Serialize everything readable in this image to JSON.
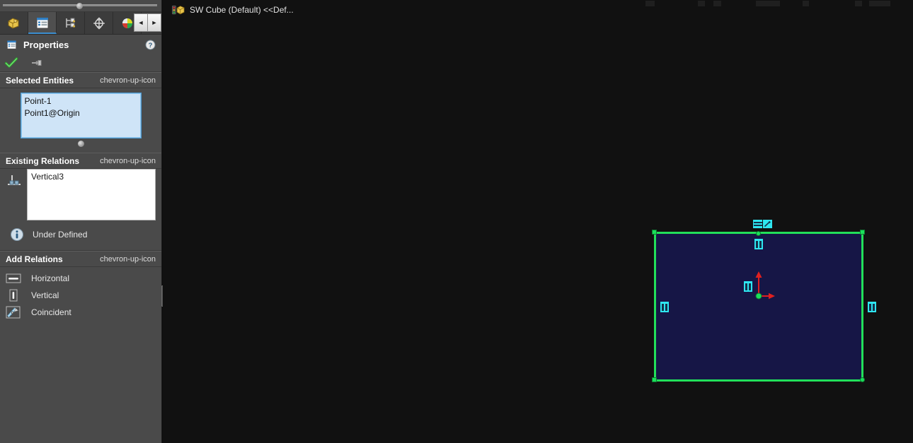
{
  "panel": {
    "tabs": [
      {
        "name": "feature-manager-design-tree",
        "icon": "cube-tree-icon",
        "active": false
      },
      {
        "name": "property-manager",
        "icon": "property-list-icon",
        "active": true
      },
      {
        "name": "configuration-manager",
        "icon": "configuration-icon",
        "active": false
      },
      {
        "name": "dimxpert-manager",
        "icon": "crosshair-target-icon",
        "active": false
      },
      {
        "name": "display-manager",
        "icon": "color-sphere-icon",
        "active": false
      }
    ],
    "nav": {
      "prev": "◄",
      "next": "►"
    },
    "header": {
      "title": "Properties",
      "icon": "property-list-icon",
      "help_icon": "help-question-icon"
    },
    "actions": {
      "ok_icon": "green-check-icon",
      "pin_icon": "pushpin-icon"
    },
    "sections": {
      "selected_entities": {
        "title": "Selected Entities",
        "collapse_icon": "chevron-up-icon",
        "items": [
          "Point-1",
          "Point1@Origin"
        ]
      },
      "existing_relations": {
        "title": "Existing Relations",
        "collapse_icon": "chevron-up-icon",
        "icon": "relation-vertical-icon",
        "items": [
          "Vertical3"
        ]
      },
      "status": {
        "icon": "info-icon",
        "text": "Under Defined"
      },
      "add_relations": {
        "title": "Add Relations",
        "collapse_icon": "chevron-up-icon",
        "items": [
          {
            "label": "Horizontal",
            "icon": "horizontal-relation-icon"
          },
          {
            "label": "Vertical",
            "icon": "vertical-relation-icon"
          },
          {
            "label": "Coincident",
            "icon": "coincident-relation-icon"
          }
        ]
      }
    }
  },
  "document": {
    "title": "SW Cube (Default) <<Def...",
    "icon": "part-document-icon"
  },
  "colors": {
    "sketch_line": "#22e05a",
    "sketch_fill": "#161646",
    "relation_badge": "#2ee6f0",
    "axis": "#e02020",
    "origin_point": "#1ae05a",
    "panel_bg": "#4a4a4a",
    "viewport_bg": "#111111",
    "selection_box": "#cfe4f7"
  },
  "viewport": {
    "relation_badges": [
      {
        "name": "horizontal-relation-badge",
        "kind": "horizontal"
      },
      {
        "name": "coincident-relation-badge",
        "kind": "diagonal"
      },
      {
        "name": "vertical-relation-badge-top",
        "kind": "vertical"
      },
      {
        "name": "vertical-relation-badge-left",
        "kind": "vertical"
      },
      {
        "name": "vertical-relation-badge-right",
        "kind": "vertical"
      },
      {
        "name": "vertical-relation-badge-center",
        "kind": "vertical"
      }
    ]
  }
}
